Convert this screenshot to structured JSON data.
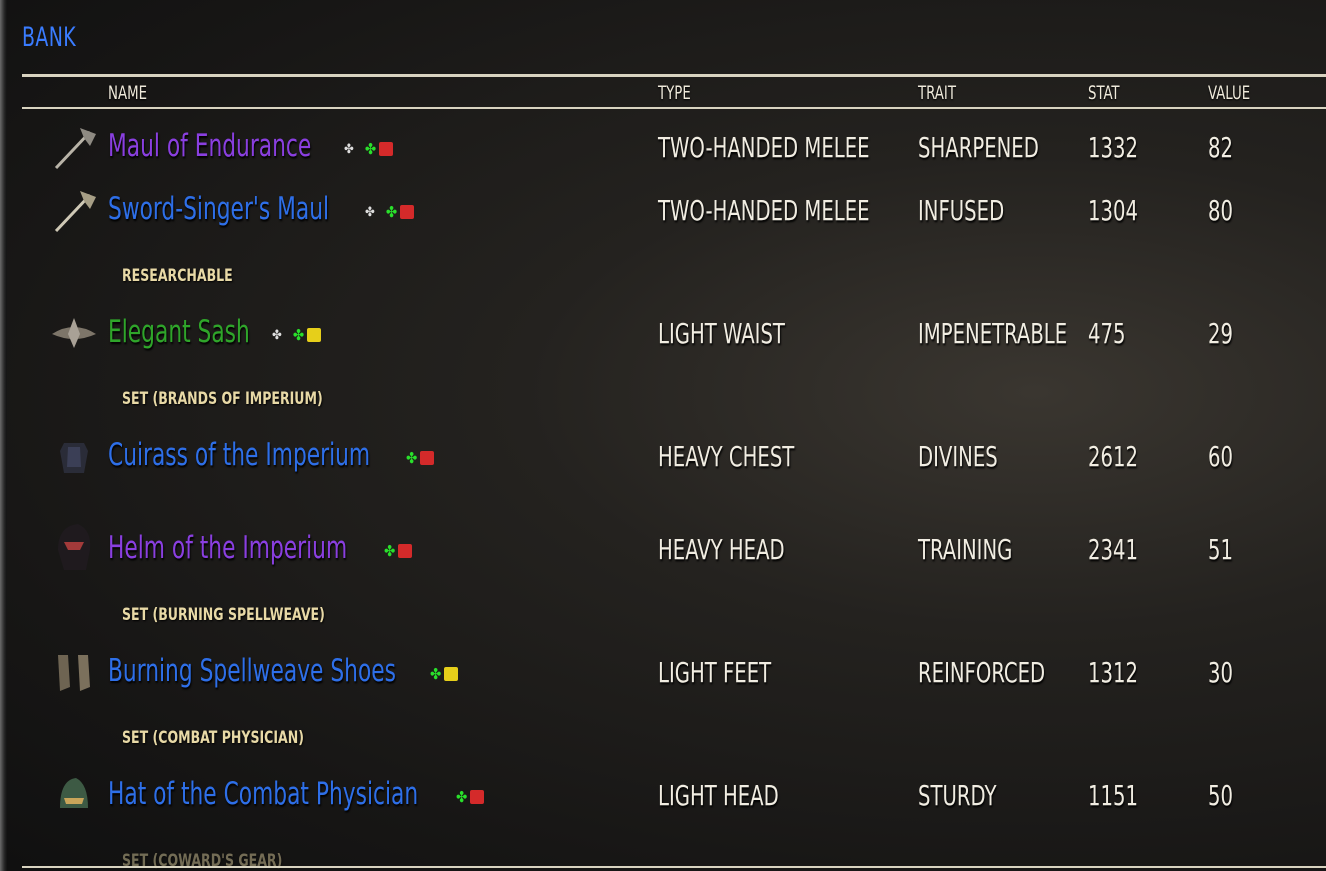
{
  "window": {
    "title": "BANK"
  },
  "columns": {
    "name": "NAME",
    "type": "TYPE",
    "trait": "TRAIT",
    "stat": "STAT",
    "value": "VALUE"
  },
  "colors": {
    "purple": "#8a3fe0",
    "blue": "#2e6fe8",
    "green": "#2fa52a",
    "status_red": "#d42a2a",
    "status_yellow": "#e6cf1a",
    "clover": "#29e02b"
  },
  "items": [
    {
      "name": "Maul of Endurance",
      "quality_color": "#8a3fe0",
      "icon": "maul-icon",
      "bound_icon": true,
      "status": "red",
      "type": "TWO-HANDED MELEE",
      "trait": "SHARPENED",
      "stat": "1332",
      "value": "82"
    },
    {
      "name": "Sword-Singer's Maul",
      "quality_color": "#2e6fe8",
      "icon": "maul-icon",
      "bound_icon": true,
      "status": "red",
      "type": "TWO-HANDED MELEE",
      "trait": "INFUSED",
      "stat": "1304",
      "value": "80"
    },
    {
      "name": "Elegant Sash",
      "quality_color": "#2fa52a",
      "icon": "sash-icon",
      "bound_icon": true,
      "status": "yellow",
      "type": "LIGHT WAIST",
      "trait": "IMPENETRABLE",
      "stat": "475",
      "value": "29"
    },
    {
      "name": "Cuirass of the Imperium",
      "quality_color": "#2e6fe8",
      "icon": "cuirass-icon",
      "bound_icon": false,
      "status": "red",
      "type": "HEAVY CHEST",
      "trait": "DIVINES",
      "stat": "2612",
      "value": "60"
    },
    {
      "name": "Helm of the Imperium",
      "quality_color": "#8a3fe0",
      "icon": "helm-icon",
      "bound_icon": false,
      "status": "red",
      "type": "HEAVY HEAD",
      "trait": "TRAINING",
      "stat": "2341",
      "value": "51"
    },
    {
      "name": "Burning Spellweave Shoes",
      "quality_color": "#2e6fe8",
      "icon": "shoes-icon",
      "bound_icon": false,
      "status": "yellow",
      "type": "LIGHT FEET",
      "trait": "REINFORCED",
      "stat": "1312",
      "value": "30"
    },
    {
      "name": "Hat of the Combat Physician",
      "quality_color": "#2e6fe8",
      "icon": "hat-icon",
      "bound_icon": false,
      "status": "red",
      "type": "LIGHT HEAD",
      "trait": "STURDY",
      "stat": "1151",
      "value": "50"
    }
  ],
  "subheaders": [
    {
      "label": "RESEARCHABLE"
    },
    {
      "label": "SET (BRANDS OF IMPERIUM)"
    },
    {
      "label": "SET (BURNING SPELLWEAVE)"
    },
    {
      "label": "SET (COMBAT PHYSICIAN)"
    },
    {
      "label": "SET (COWARD'S GEAR)"
    }
  ]
}
